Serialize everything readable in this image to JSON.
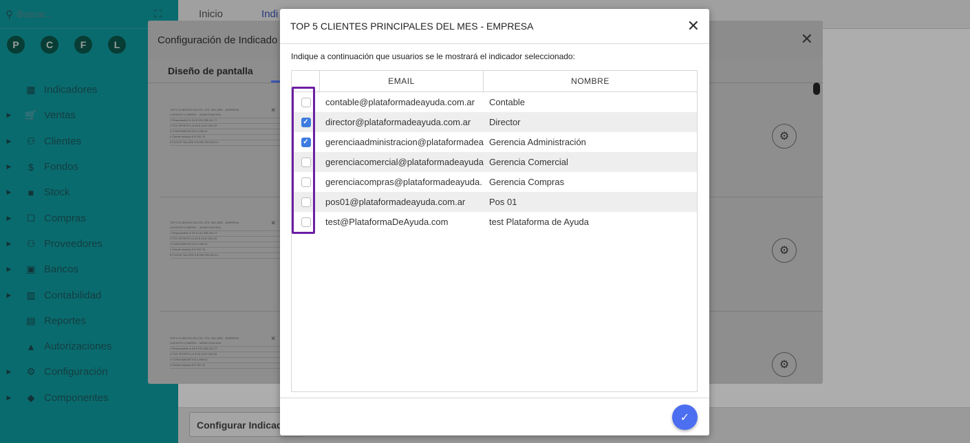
{
  "sidebar": {
    "search_placeholder": "Buscar...",
    "avatars": [
      "P",
      "C",
      "F",
      "L"
    ],
    "items": [
      {
        "label": "Indicadores",
        "icon": "dashboard-icon",
        "has_arrow": false
      },
      {
        "label": "Ventas",
        "icon": "cart-icon",
        "has_arrow": true
      },
      {
        "label": "Clientes",
        "icon": "people-icon",
        "has_arrow": true
      },
      {
        "label": "Fondos",
        "icon": "dollar-icon",
        "has_arrow": true
      },
      {
        "label": "Stock",
        "icon": "box-icon",
        "has_arrow": true
      },
      {
        "label": "Compras",
        "icon": "basket-icon",
        "has_arrow": true
      },
      {
        "label": "Proveedores",
        "icon": "people-icon",
        "has_arrow": true
      },
      {
        "label": "Bancos",
        "icon": "briefcase-icon",
        "has_arrow": true
      },
      {
        "label": "Contabilidad",
        "icon": "book-icon",
        "has_arrow": true
      },
      {
        "label": "Reportes",
        "icon": "report-icon",
        "has_arrow": false
      },
      {
        "label": "Autorizaciones",
        "icon": "lock-icon",
        "has_arrow": false
      },
      {
        "label": "Configuración",
        "icon": "gears-icon",
        "has_arrow": true
      },
      {
        "label": "Componentes",
        "icon": "tag-icon",
        "has_arrow": true
      }
    ]
  },
  "topbar": {
    "tabs": [
      "Inicio",
      "Indi"
    ]
  },
  "bottom": {
    "configure_button": "Configurar Indicad"
  },
  "dialog2": {
    "title": "Configuración de Indicado",
    "tab": "Diseño de pantalla",
    "thumb_title": "TOP 5 CLIENTES EN CTA. CTE. DEL AÑO - EMPRESA",
    "thumb_header": "CLIENTES     COMPRO...     MONETIZACION",
    "thumb_rows": [
      "1  Responsable in      54      $ 133,338,341.77",
      "2  FOX SPORTS LA       33      $ 4,047,302.03",
      "3  CONSUMIDOR          8       $ 1,906.42",
      "4  Cliente relacion    8       $ 702.76",
      "5  FUCILE TALLERI      6       $ 256,765,303.14"
    ]
  },
  "modal": {
    "title": "TOP 5 CLIENTES PRINCIPALES DEL MES - EMPRESA",
    "subtitle": "Indique a continuación que usuarios se le mostrará el indicador seleccionado:",
    "columns": {
      "email": "EMAIL",
      "name": "NOMBRE"
    },
    "rows": [
      {
        "email": "contable@plataformadeayuda.com.ar",
        "name": "Contable",
        "checked": false
      },
      {
        "email": "director@plataformadeayuda.com.ar",
        "name": "Director",
        "checked": true
      },
      {
        "email": "gerenciaadministracion@plataformadea",
        "name": "Gerencia Administración",
        "checked": true
      },
      {
        "email": "gerenciacomercial@plataformadeayuda",
        "name": "Gerencia Comercial",
        "checked": false
      },
      {
        "email": "gerenciacompras@plataformadeayuda.",
        "name": "Gerencia Compras",
        "checked": false
      },
      {
        "email": "pos01@plataformadeayuda.com.ar",
        "name": "Pos 01",
        "checked": false
      },
      {
        "email": "test@PlataformaDeAyuda.com",
        "name": "test Plataforma de Ayuda",
        "checked": false
      }
    ],
    "confirm_icon": "check-icon",
    "close_icon": "close-icon"
  },
  "colors": {
    "sidebar": "#0f9ea3",
    "accent": "#4c6ef0",
    "checkbox_checked": "#3d7be0",
    "highlight": "#6c1ea3"
  }
}
